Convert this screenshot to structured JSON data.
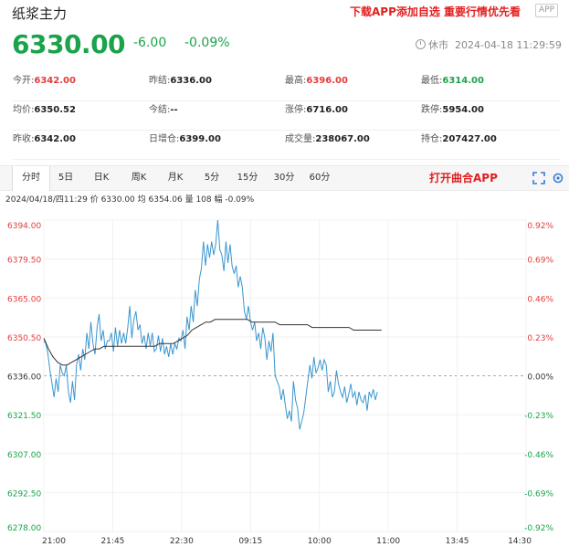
{
  "header": {
    "title": "纸浆主力",
    "promo": "下载APP添加自选 重要行情优先看",
    "app_badge": "APP",
    "price": "6330.00",
    "change": "-6.00",
    "change_pct": "-0.09%",
    "status": "休市",
    "datetime": "2024-04-18 11:29:59"
  },
  "stats": [
    [
      {
        "label": "今开:",
        "value": "6342.00",
        "color": "red"
      },
      {
        "label": "昨结:",
        "value": "6336.00",
        "color": ""
      },
      {
        "label": "最高:",
        "value": "6396.00",
        "color": "red"
      },
      {
        "label": "最低:",
        "value": "6314.00",
        "color": "green"
      }
    ],
    [
      {
        "label": "均价:",
        "value": "6350.52",
        "color": ""
      },
      {
        "label": "今结:",
        "value": "--",
        "color": ""
      },
      {
        "label": "涨停:",
        "value": "6716.00",
        "color": ""
      },
      {
        "label": "跌停:",
        "value": "5954.00",
        "color": ""
      }
    ],
    [
      {
        "label": "昨收:",
        "value": "6342.00",
        "color": ""
      },
      {
        "label": "日增仓:",
        "value": "6399.00",
        "color": ""
      },
      {
        "label": "成交量:",
        "value": "238067.00",
        "color": ""
      },
      {
        "label": "持仓:",
        "value": "207427.00",
        "color": ""
      }
    ]
  ],
  "tabs": [
    "分时",
    "5日",
    "日K",
    "周K",
    "月K",
    "5分",
    "15分",
    "30分",
    "60分"
  ],
  "active_tab": 0,
  "open_app": "打开曲合APP",
  "info_line": "2024/04/18/四11:29  价 6330.00  均 6354.06  量 108  幅 -0.09%",
  "colors": {
    "up": "#e23c3c",
    "down": "#1aa34a",
    "price_line": "#3a96d0",
    "avg_line": "#333333"
  },
  "chart_data": {
    "type": "line",
    "ylim": [
      6278,
      6394
    ],
    "ref_price": 6336,
    "y_ticks": [
      "6394.00",
      "6379.50",
      "6365.00",
      "6350.50",
      "6336.00",
      "6321.50",
      "6307.00",
      "6292.50",
      "6278.00"
    ],
    "pct_ticks": [
      "0.92%",
      "0.69%",
      "0.46%",
      "0.23%",
      "0.00%",
      "-0.23%",
      "-0.46%",
      "-0.69%",
      "-0.92%"
    ],
    "x_ticks": [
      "21:00",
      "21:45",
      "22:30",
      "09:15",
      "10:00",
      "11:00",
      "13:45",
      "14:30"
    ],
    "series": [
      {
        "values": [
          6349,
          6348,
          6344,
          6338,
          6333,
          6328,
          6335,
          6330,
          6340,
          6337,
          6336,
          6340,
          6330,
          6326,
          6334,
          6327,
          6340,
          6344,
          6338,
          6346,
          6342,
          6352,
          6346,
          6356,
          6348,
          6344,
          6354,
          6359,
          6349,
          6353,
          6346,
          6349,
          6349,
          6352,
          6345,
          6354,
          6347,
          6353,
          6348,
          6352,
          6348,
          6354,
          6362,
          6350,
          6357,
          6360,
          6353,
          6355,
          6348,
          6351,
          6346,
          6352,
          6347,
          6352,
          6345,
          6346,
          6351,
          6345,
          6350,
          6344,
          6347,
          6343,
          6348,
          6344,
          6348,
          6346,
          6350,
          6349,
          6353,
          6346,
          6358,
          6353,
          6362,
          6356,
          6368,
          6362,
          6372,
          6376,
          6386,
          6377,
          6385,
          6380,
          6386,
          6381,
          6385,
          6394,
          6383,
          6381,
          6375,
          6386,
          6378,
          6385,
          6377,
          6374,
          6377,
          6369,
          6373,
          6369,
          6360,
          6357,
          6362,
          6356,
          6353,
          6356,
          6349,
          6352,
          6346,
          6354,
          6350,
          6342,
          6349,
          6345,
          6352,
          6336,
          6334,
          6332,
          6327,
          6331,
          6325,
          6320,
          6323,
          6319,
          6334,
          6327,
          6324,
          6316,
          6319,
          6322,
          6328,
          6334,
          6340,
          6335,
          6343,
          6337,
          6339,
          6342,
          6338,
          6342,
          6340,
          6330,
          6334,
          6328,
          6330,
          6338,
          6333,
          6330,
          6328,
          6332,
          6326,
          6329,
          6333,
          6328,
          6330,
          6325,
          6330,
          6327,
          6326,
          6329,
          6323,
          6330,
          6328,
          6331,
          6327,
          6330
        ]
      },
      {
        "values": [
          6350,
          6346,
          6343,
          6341,
          6340,
          6340,
          6341,
          6342,
          6343,
          6344,
          6345,
          6346,
          6346,
          6347,
          6347,
          6347,
          6347,
          6347,
          6347,
          6347,
          6347,
          6347,
          6347,
          6347,
          6347,
          6348,
          6348,
          6348,
          6348,
          6349,
          6350,
          6351,
          6353,
          6354,
          6355,
          6356,
          6356,
          6357,
          6357,
          6357,
          6357,
          6357,
          6357,
          6357,
          6357,
          6356,
          6356,
          6356,
          6356,
          6356,
          6356,
          6355,
          6355,
          6355,
          6355,
          6355,
          6355,
          6355,
          6354,
          6354,
          6354,
          6354,
          6354,
          6354,
          6354,
          6354,
          6354,
          6353,
          6353,
          6353,
          6353,
          6353,
          6353,
          6353
        ]
      }
    ]
  }
}
